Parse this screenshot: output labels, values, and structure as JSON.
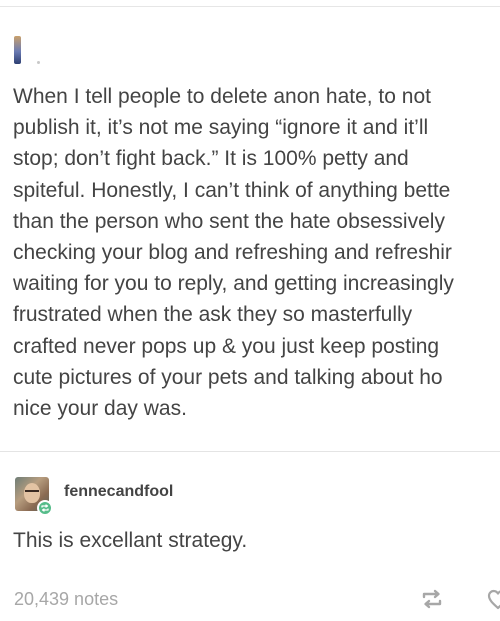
{
  "post": {
    "lines": [
      "When I tell people to delete anon hate, to not",
      "publish it, it’s not me saying “ignore it and it’ll",
      "stop; don’t fight back.” It is 100% petty and",
      "spiteful. Honestly, I can’t think of anything bette",
      "than the person who sent the hate obsessively",
      "checking your blog and refreshing and refreshir",
      "waiting for you to reply, and getting increasingly",
      "frustrated when the ask they so masterfully",
      "crafted never pops up & you just keep posting",
      "cute pictures of your pets and talking about ho",
      "nice your day was."
    ]
  },
  "reblog": {
    "username": "fennecandfool",
    "comment": "This is excellant strategy."
  },
  "footer": {
    "notes": "20,439 notes"
  },
  "icons": {
    "reblog": "reblog-icon",
    "like": "heart-icon",
    "reblog_badge": "reblog-badge-icon"
  },
  "colors": {
    "text": "#444444",
    "muted": "#a7a7a7",
    "reblog_green": "#56bc8a"
  }
}
